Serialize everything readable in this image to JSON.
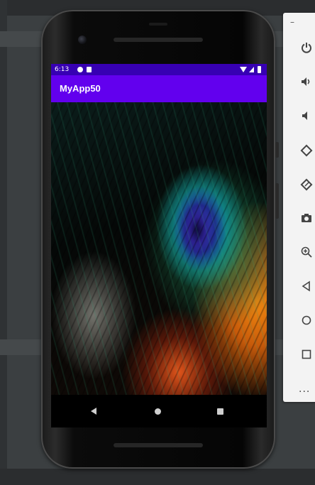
{
  "status_bar": {
    "time": "6:13"
  },
  "app_bar": {
    "title": "MyApp50"
  },
  "toolbar": {
    "minimize": "–",
    "more": "..."
  },
  "colors": {
    "status_bar": "#3700b3",
    "app_bar": "#6200ee",
    "toolbar_bg": "#f3f3f3"
  },
  "icons": [
    "power-icon",
    "volume-up-icon",
    "volume-down-icon",
    "rotate-left-icon",
    "rotate-right-icon",
    "camera-icon",
    "zoom-icon",
    "back-icon",
    "home-icon",
    "overview-icon"
  ]
}
